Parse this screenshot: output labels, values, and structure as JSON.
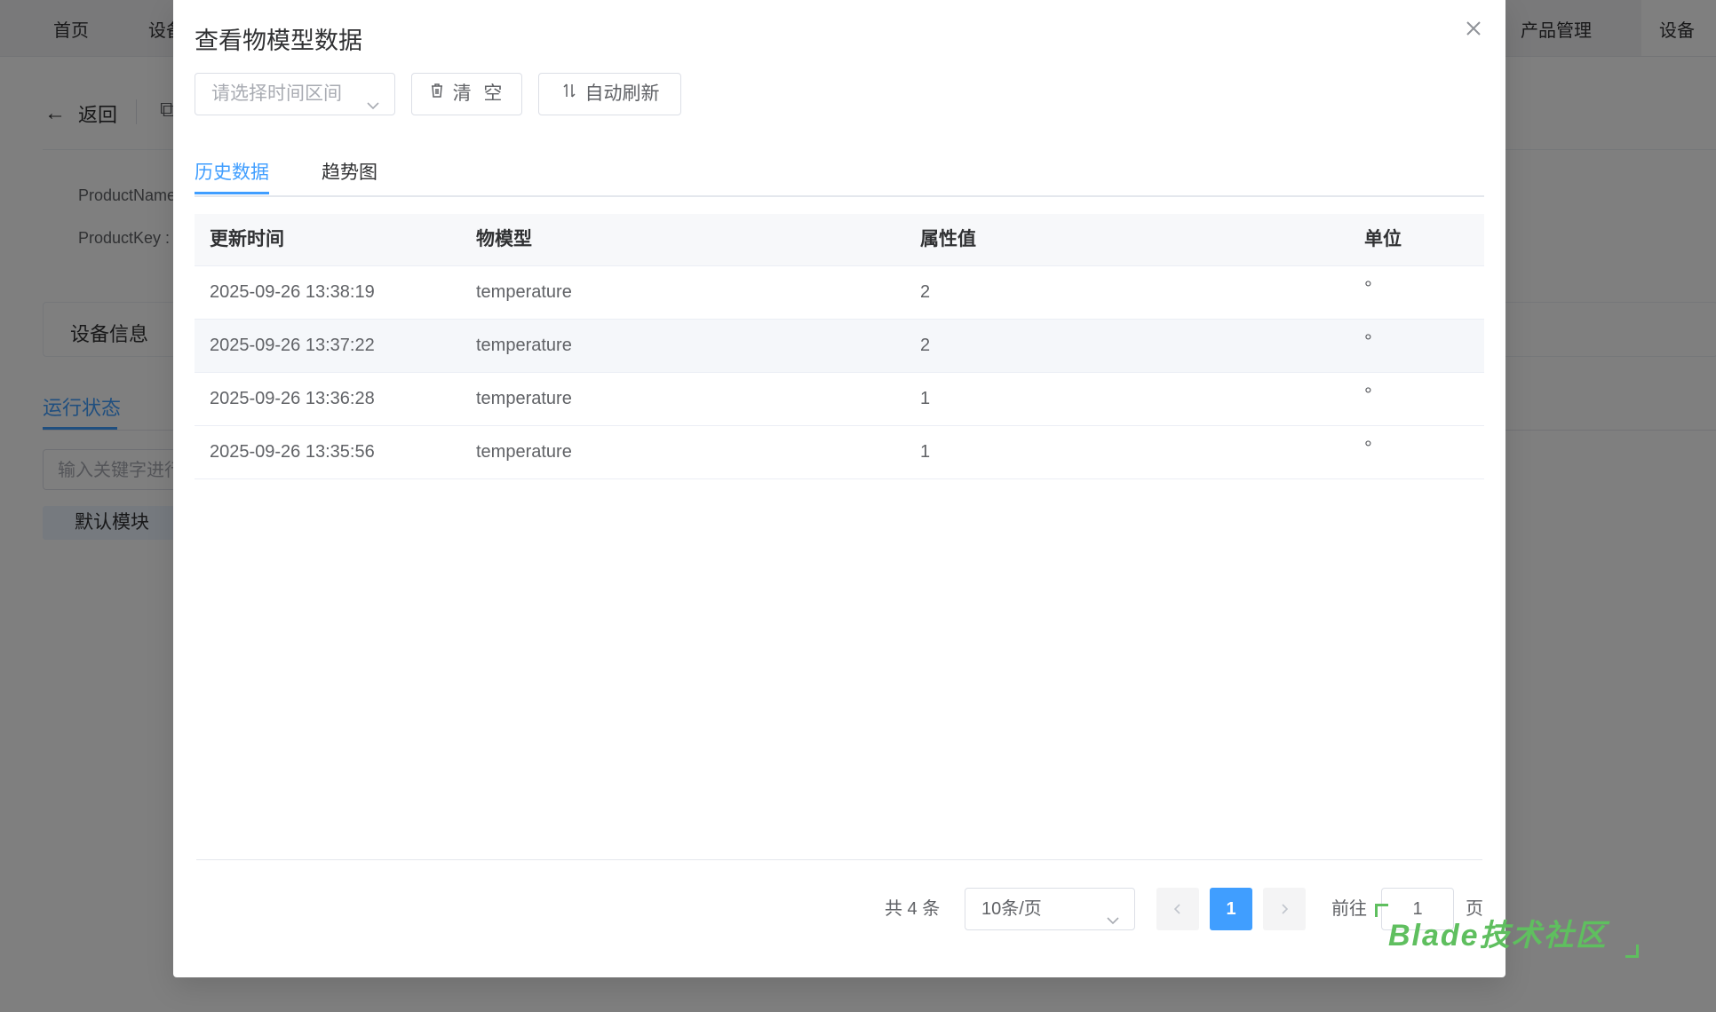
{
  "background": {
    "tabs": [
      "首页",
      "设备",
      "产品管理",
      "设备详情"
    ],
    "back_label": "返回",
    "fields": [
      "ProductName",
      "ProductKey :"
    ],
    "info_tab": "设备信息",
    "run_tab": "运行状态",
    "search_placeholder": "输入关键字进行",
    "module_tag": "默认模块"
  },
  "dialog": {
    "title": "查看物模型数据",
    "close_icon": "close-icon",
    "toolbar": {
      "time_range_placeholder": "请选择时间区间",
      "clear_label": "清 空",
      "refresh_label": "自动刷新"
    },
    "tabs": [
      {
        "label": "历史数据",
        "active": true
      },
      {
        "label": "趋势图",
        "active": false
      }
    ],
    "table": {
      "columns": [
        "更新时间",
        "物模型",
        "属性值",
        "单位"
      ],
      "rows": [
        [
          "2025-09-26 13:38:19",
          "temperature",
          "2",
          "°"
        ],
        [
          "2025-09-26 13:37:22",
          "temperature",
          "2",
          "°"
        ],
        [
          "2025-09-26 13:36:28",
          "temperature",
          "1",
          "°"
        ],
        [
          "2025-09-26 13:35:56",
          "temperature",
          "1",
          "°"
        ]
      ]
    },
    "pagination": {
      "total_label": "共 4 条",
      "page_size": "10条/页",
      "current_page": "1",
      "goto_label": "前往",
      "goto_value": "1",
      "goto_unit": "页"
    }
  },
  "watermark": "Blade技术社区",
  "colors": {
    "accent": "#409eff",
    "overlay": "rgba(0,0,0,0.5)",
    "watermark": "#5fbf5f"
  }
}
